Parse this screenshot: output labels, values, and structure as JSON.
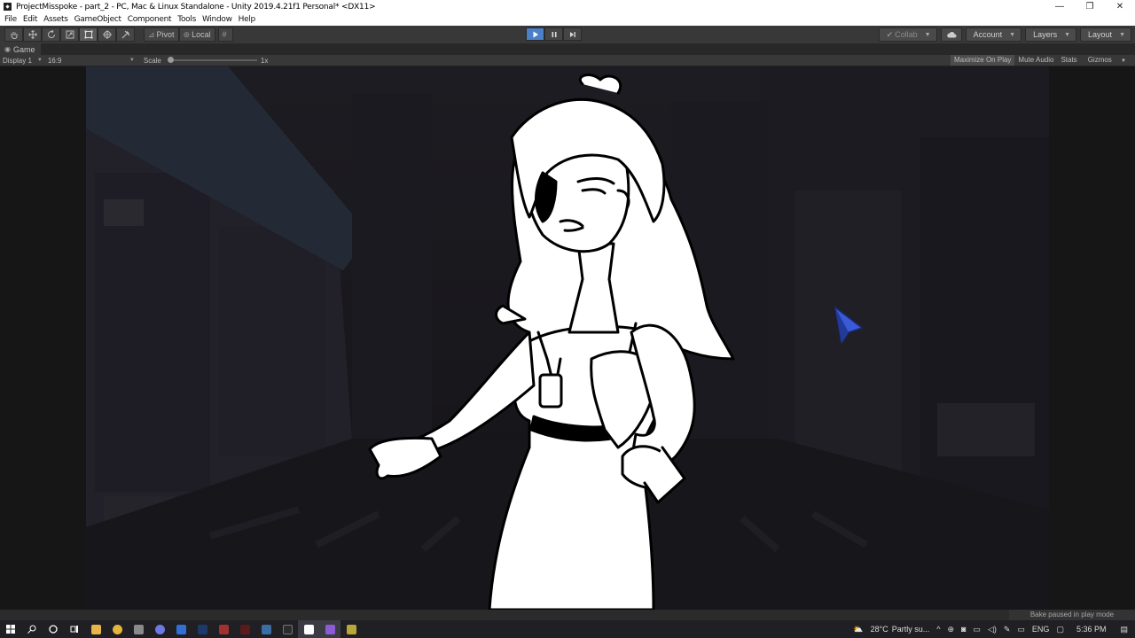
{
  "window": {
    "title": "ProjectMisspoke - part_2 - PC, Mac & Linux Standalone - Unity 2019.4.21f1 Personal* <DX11>",
    "controls": [
      "—",
      "❐",
      "✕"
    ]
  },
  "menu": [
    "File",
    "Edit",
    "Assets",
    "GameObject",
    "Component",
    "Tools",
    "Window",
    "Help"
  ],
  "toolbar": {
    "pivot": "Pivot",
    "local": "Local",
    "collab": "Collab",
    "account": "Account",
    "layers": "Layers",
    "layout": "Layout"
  },
  "game_tab": {
    "label": "Game",
    "display": "Display 1",
    "aspect": "16:9",
    "scale_label": "Scale",
    "scale_value": "1x",
    "maximize": "Maximize On Play",
    "mute": "Mute Audio",
    "stats": "Stats",
    "gizmos": "Gizmos"
  },
  "status": {
    "message": "Bake paused in play mode"
  },
  "taskbar": {
    "weather_temp": "28°C",
    "weather_text": "Partly su...",
    "language": "ENG",
    "time": "5:36 PM"
  },
  "colors": {
    "play_active": "#4a7fc9",
    "editor_bg": "#383838",
    "scene_bg": "#131217"
  }
}
